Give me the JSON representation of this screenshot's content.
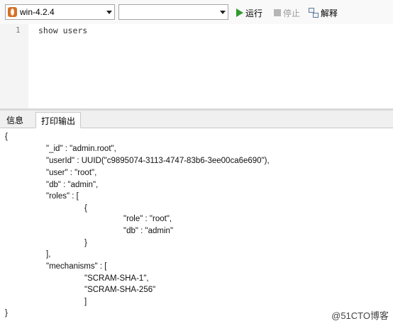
{
  "toolbar": {
    "connection": {
      "label": "win-4.2.4",
      "icon": "leaf-db-icon"
    },
    "database": {
      "label": ""
    },
    "run_label": "运行",
    "stop_label": "停止",
    "explain_label": "解释"
  },
  "editor": {
    "line_numbers": [
      "1"
    ],
    "lines": [
      "show users"
    ]
  },
  "tabs": {
    "info": "信息",
    "print_output": "打印输出",
    "active": "print_output"
  },
  "output": {
    "lines": [
      "{",
      "\"_id\" : \"admin.root\",",
      "\"userId\" : UUID(\"c9895074-3113-4747-83b6-3ee00ca6e690\"),",
      "\"user\" : \"root\",",
      "\"db\" : \"admin\",",
      "\"roles\" : [",
      "{",
      "\"role\" : \"root\",",
      "\"db\" : \"admin\"",
      "}",
      "],",
      "\"mechanisms\" : [",
      "\"SCRAM-SHA-1\",",
      "\"SCRAM-SHA-256\"",
      "]",
      "}"
    ]
  },
  "watermark": "@51CTO博客"
}
